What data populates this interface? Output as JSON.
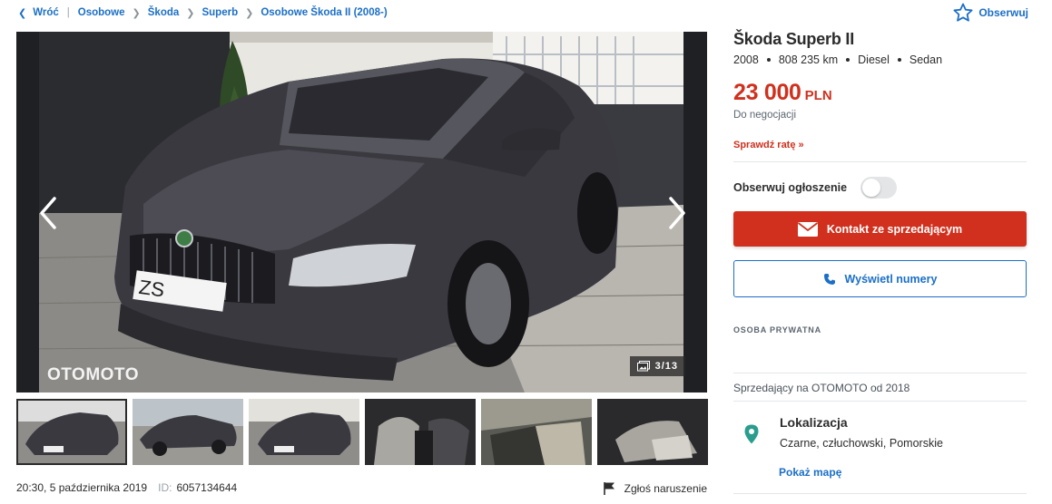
{
  "breadcrumb": {
    "back_label": "Wróć",
    "items": [
      "Osobowe",
      "Škoda",
      "Superb",
      "Osobowe Škoda II (2008-)"
    ]
  },
  "header": {
    "watch_label": "Obserwuj",
    "watch_icon": "star-outline-icon"
  },
  "gallery": {
    "counter": "3/13",
    "counter_icon": "photos-icon",
    "watermark": "OTOMOTO",
    "plate_text": "ZS",
    "prev_icon": "chevron-left-icon",
    "next_icon": "chevron-right-icon",
    "thumb_count": 6,
    "active_thumb": 1
  },
  "meta": {
    "date": "20:30, 5 października 2019",
    "id_label": "ID:",
    "id_value": "6057134644",
    "report_label": "Zgłoś naruszenie",
    "report_icon": "flag-icon"
  },
  "listing": {
    "title": "Škoda Superb II",
    "specs": [
      "2008",
      "808 235 km",
      "Diesel",
      "Sedan"
    ],
    "price": "23 000",
    "currency": "PLN",
    "negotiable": "Do negocjacji",
    "check_rate": "Sprawdź ratę »"
  },
  "actions": {
    "observe_label": "Obserwuj ogłoszenie",
    "observe_on": false,
    "contact_label": "Kontakt ze sprzedającym",
    "contact_icon": "envelope-icon",
    "phone_label": "Wyświetl numery",
    "phone_icon": "phone-icon"
  },
  "seller": {
    "type": "OSOBA PRYWATNA",
    "since": "Sprzedający na OTOMOTO od 2018"
  },
  "location": {
    "title": "Lokalizacja",
    "address": "Czarne, człuchowski, Pomorskie",
    "map_link": "Pokaż mapę",
    "icon": "map-pin-icon"
  },
  "colors": {
    "accent_blue": "#1b6fc7",
    "price_red": "#d0301d",
    "button_red": "#d0301d"
  }
}
